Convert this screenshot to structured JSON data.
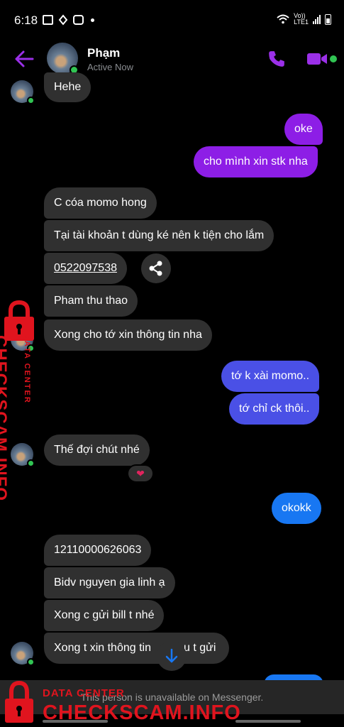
{
  "status_bar": {
    "time": "6:18",
    "network_top": "Vo))",
    "network_bottom": "LTE1"
  },
  "header": {
    "contact_name": "Phạm",
    "contact_status": "Active Now"
  },
  "messages": {
    "m1": "Hehe",
    "m2": "oke",
    "m3": "cho mình xin stk nha",
    "m4": "C cóa momo hong",
    "m5": "Tại tài khoản t dùng ké nên k tiện cho lắm",
    "m6": "0522097538",
    "m7": "Pham thu thao",
    "m8": "Xong cho tớ xin thông tin nha",
    "m9": "tớ k xài momo..",
    "m10": "tớ chỉ ck thôi..",
    "m11": "Thế đợi chút nhé",
    "m12": "okokk",
    "m13": "12110000626063",
    "m14": "Bidv nguyen gia linh ạ",
    "m15": "Xong c gửi bill t nhé",
    "m16": "Xong t xin thông tin",
    "m16_tail": "u t gửi"
  },
  "reaction": "❤",
  "footer": {
    "unavailable_text": "This person is unavailable on Messenger."
  },
  "watermark": {
    "label": "DATA CENTER",
    "brand": "CHECKSCAM.INFO",
    "side_label": "DATA CENTER",
    "side_brand": "CHECKSCAM.INFO"
  },
  "colors": {
    "accent": "#9b30e8",
    "presence": "#31c453",
    "incoming_bubble": "#303030",
    "outgoing_purple": "#8d1ee6",
    "outgoing_blue": "#1877f2",
    "watermark": "#e0141e"
  }
}
